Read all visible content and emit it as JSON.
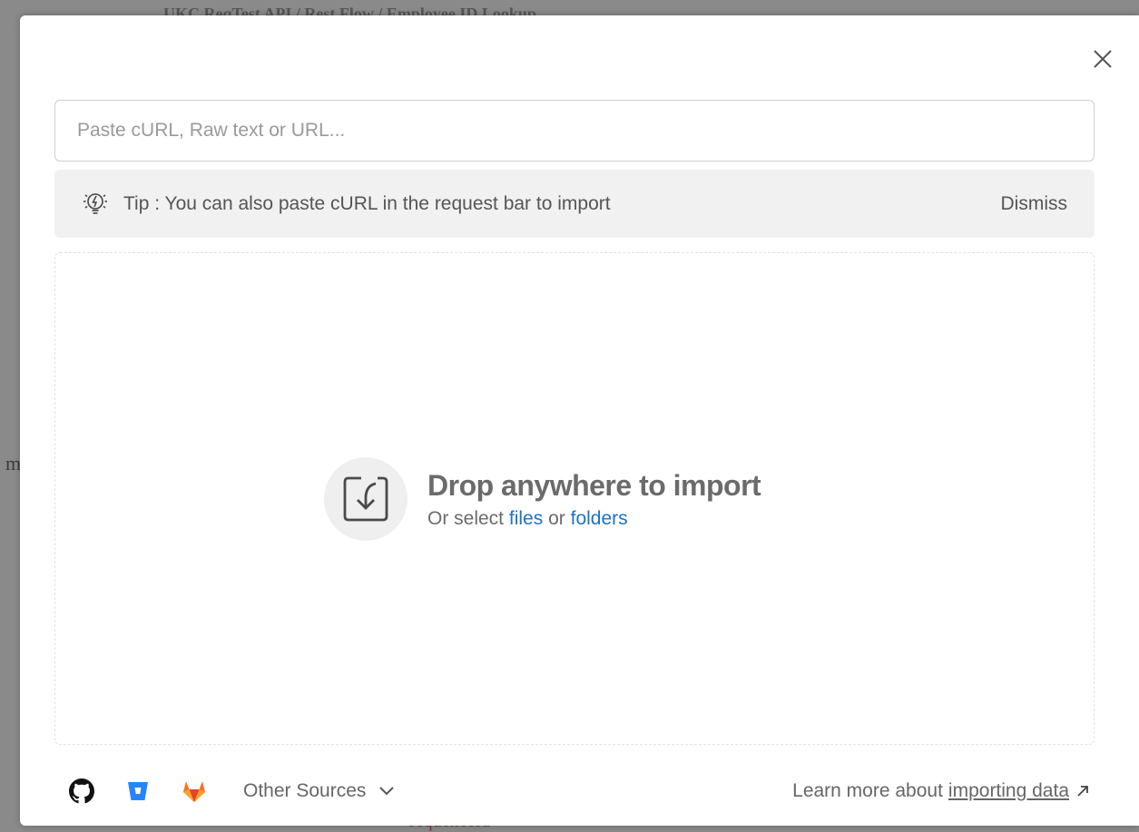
{
  "background": {
    "left_fragment": "m",
    "top_fragment": "UKC ReqTest API / Rest Flow / Employee ID Lookup",
    "bottom_fragment": "sequenceId"
  },
  "modal": {
    "input": {
      "placeholder": "Paste cURL, Raw text or URL...",
      "value": ""
    },
    "tip": {
      "text": "Tip : You can also paste cURL in the request bar to import",
      "dismiss_label": "Dismiss",
      "icon": "lightbulb-icon"
    },
    "dropzone": {
      "title": "Drop anywhere to import",
      "subtitle_prefix": "Or select",
      "files_link": "files",
      "or_word": "or",
      "folders_link": "folders",
      "icon": "import-icon"
    },
    "footer": {
      "sources": [
        "github-icon",
        "bitbucket-icon",
        "gitlab-icon"
      ],
      "other_sources_label": "Other Sources",
      "learn_prefix": "Learn more about",
      "learn_link": "importing data"
    }
  },
  "colors": {
    "link": "#1d72c9",
    "bitbucket": "#2684ff",
    "gitlab": "#fc6d26",
    "github": "#111111"
  }
}
